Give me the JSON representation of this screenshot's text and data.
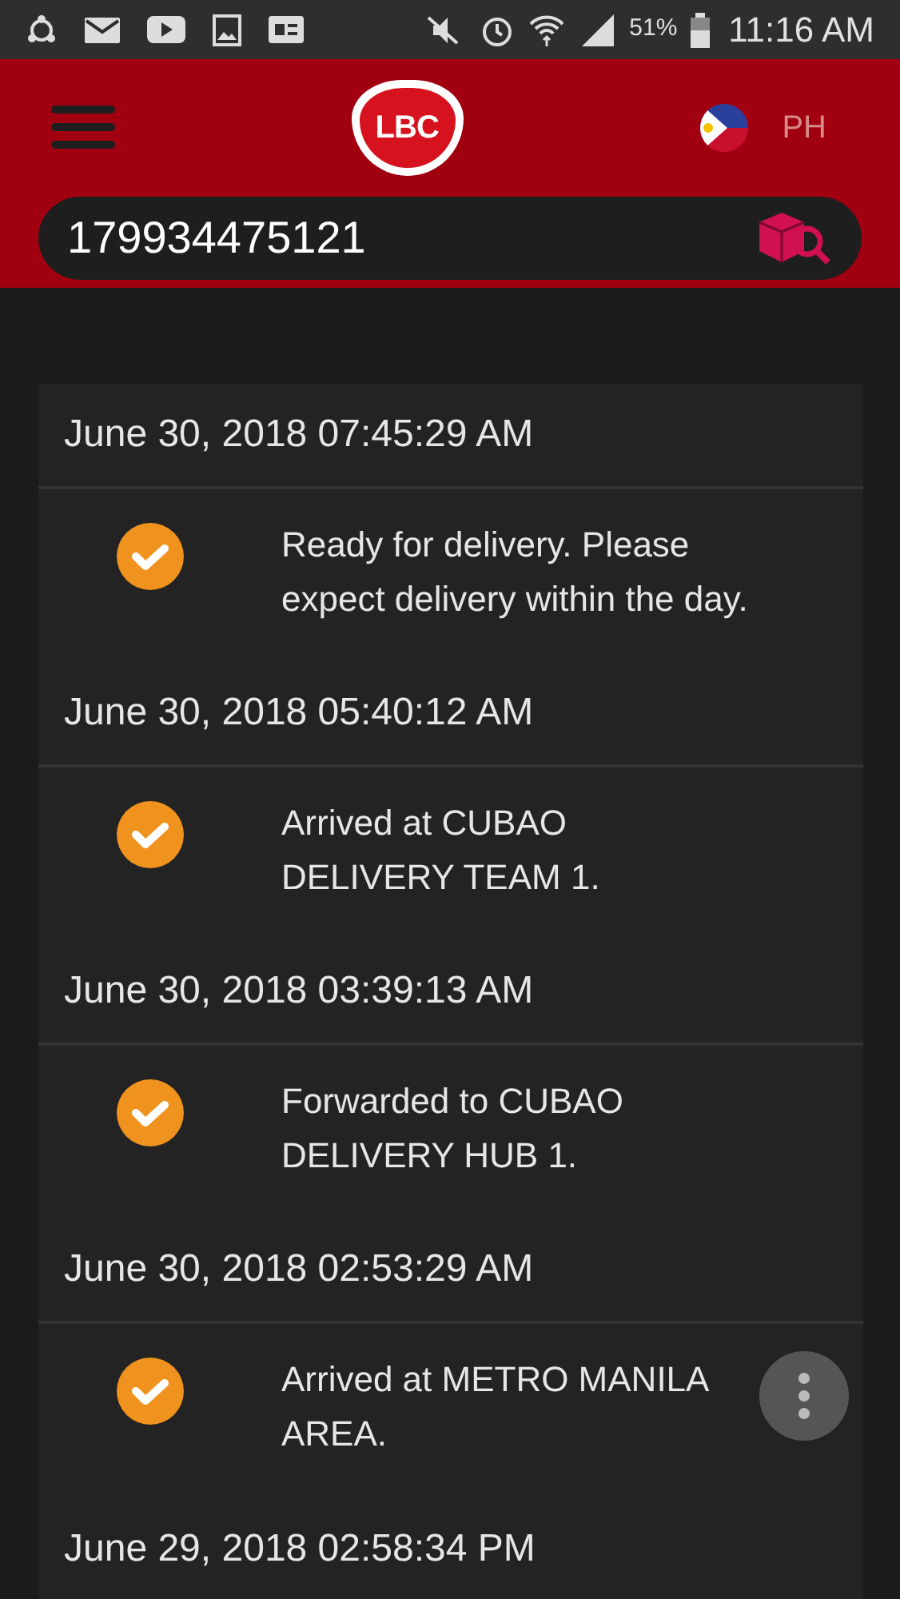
{
  "status_bar": {
    "battery": "51%",
    "time": "11:16 AM"
  },
  "header": {
    "logo": "LBC",
    "country": "PH"
  },
  "search": {
    "value": "179934475121"
  },
  "events": [
    {
      "date": "June 30, 2018 07:45:29 AM",
      "done": true,
      "text": "Ready for delivery. Please expect delivery within the day."
    },
    {
      "date": "June 30, 2018 05:40:12 AM",
      "done": true,
      "text": "Arrived at CUBAO DELIVERY TEAM 1."
    },
    {
      "date": "June 30, 2018 03:39:13 AM",
      "done": true,
      "text": "Forwarded to CUBAO DELIVERY HUB 1."
    },
    {
      "date": "June 30, 2018 02:53:29 AM",
      "done": true,
      "text": "Arrived at METRO MANILA AREA."
    },
    {
      "date": "June 29, 2018 02:58:34 PM"
    }
  ]
}
